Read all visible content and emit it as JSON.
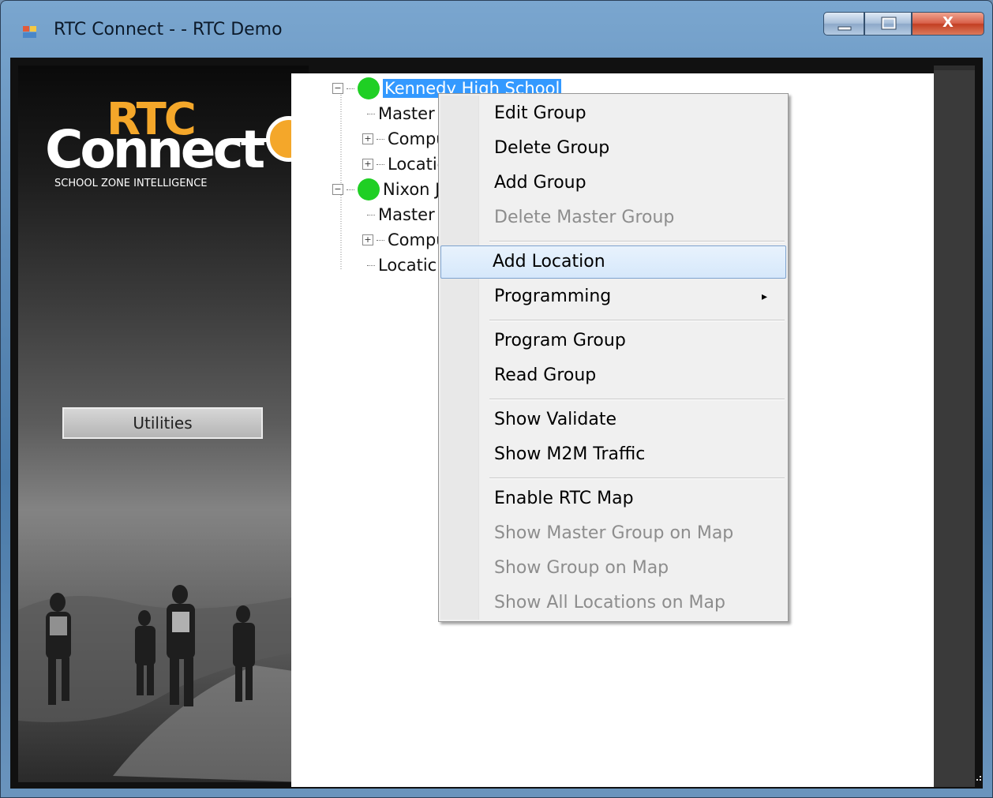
{
  "window": {
    "title": "RTC Connect - -  RTC Demo",
    "icon": "app-window-icon",
    "controls": {
      "minimize": "minimize-icon",
      "maximize": "maximize-icon",
      "close": "close-icon",
      "close_glyph": "X"
    }
  },
  "branding": {
    "logo_top": "RTC",
    "logo_main": "Connect",
    "tagline": "SCHOOL ZONE INTELLIGENCE",
    "accent_color": "#f4a72a"
  },
  "left_panel": {
    "utilities_button": "Utilities"
  },
  "tree": {
    "items": [
      {
        "label": "Kennedy High School",
        "level": 0,
        "expander": "−",
        "status_dot": "#1fcf24",
        "selected": true
      },
      {
        "label": "Master",
        "level": 1,
        "expander": ""
      },
      {
        "label": "Compu",
        "level": 1,
        "expander": "+"
      },
      {
        "label": "Locatic",
        "level": 1,
        "expander": "+"
      },
      {
        "label": "Nixon Ji",
        "level": 0,
        "expander": "−",
        "status_dot": "#1fcf24"
      },
      {
        "label": "Master",
        "level": 1,
        "expander": ""
      },
      {
        "label": "Compu",
        "level": 1,
        "expander": "+"
      },
      {
        "label": "Locatic",
        "level": 1,
        "expander": ""
      }
    ]
  },
  "context_menu": {
    "items": [
      {
        "label": "Edit Group",
        "enabled": true
      },
      {
        "label": "Delete Group",
        "enabled": true
      },
      {
        "label": "Add Group",
        "enabled": true
      },
      {
        "label": "Delete Master Group",
        "enabled": false
      },
      {
        "label": "Add Location",
        "enabled": true,
        "highlighted": true
      },
      {
        "label": "Programming",
        "enabled": true,
        "submenu": true
      },
      {
        "label": "Program Group",
        "enabled": true
      },
      {
        "label": "Read Group",
        "enabled": true
      },
      {
        "label": "Show Validate",
        "enabled": true
      },
      {
        "label": "Show M2M Traffic",
        "enabled": true
      },
      {
        "label": "Enable RTC Map",
        "enabled": true
      },
      {
        "label": "Show Master Group on Map",
        "enabled": false
      },
      {
        "label": "Show Group on Map",
        "enabled": false
      },
      {
        "label": "Show All Locations on Map",
        "enabled": false
      }
    ],
    "submenu_arrow": "▸"
  }
}
